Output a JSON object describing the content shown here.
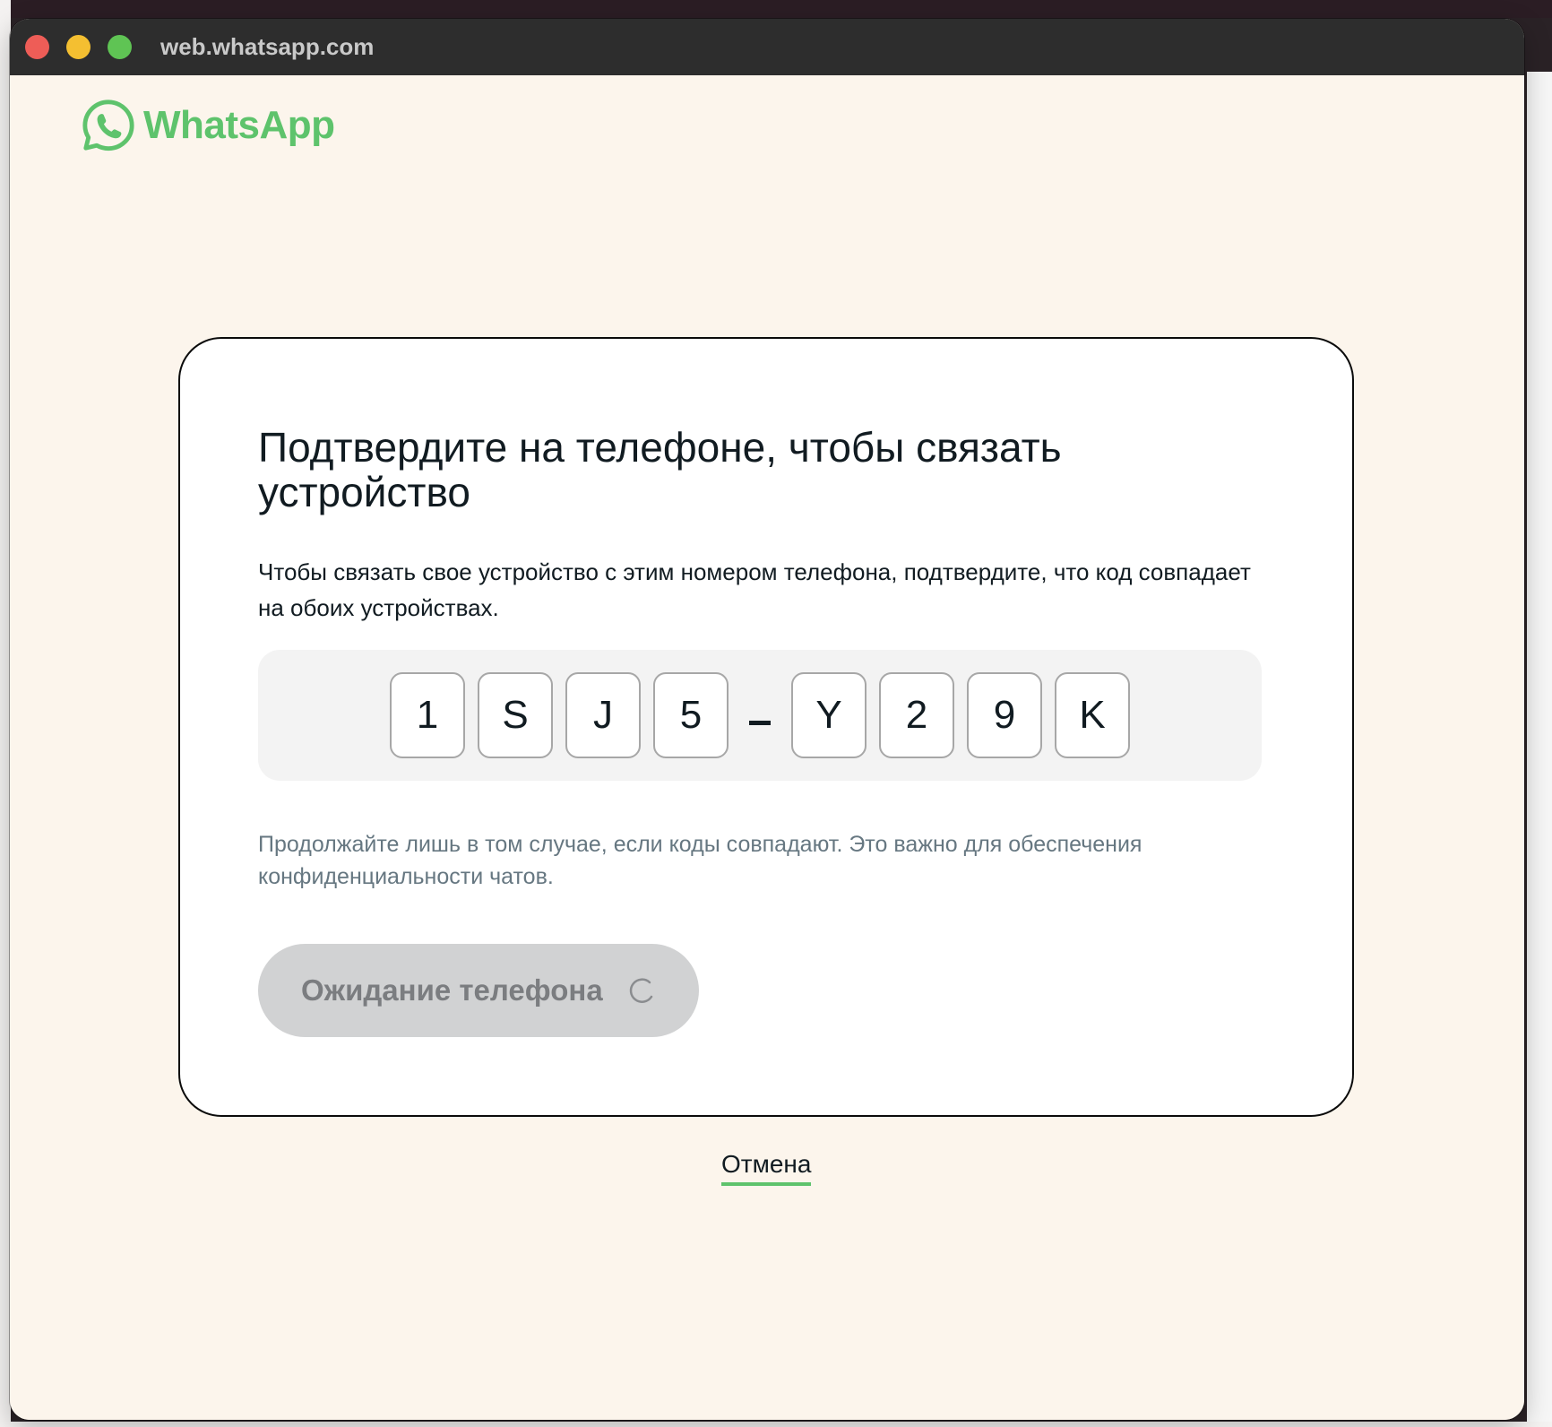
{
  "browser": {
    "url": "web.whatsapp.com"
  },
  "brand": {
    "name": "WhatsApp",
    "color": "#5ec36c",
    "icon": "whatsapp-logo-icon"
  },
  "dialog": {
    "title": "Подтвердите на телефоне, чтобы связать устройство",
    "description": "Чтобы связать свое устройство с этим номером телефона, подтвердите, что код совпадает на обоих устройствах.",
    "code_part1": [
      "1",
      "S",
      "J",
      "5"
    ],
    "code_separator": "-",
    "code_part2": [
      "Y",
      "2",
      "9",
      "K"
    ],
    "note": "Продолжайте лишь в том случае, если коды совпадают. Это важно для обеспечения конфиденциальности чатов.",
    "wait_button_label": "Ожидание телефона",
    "wait_button_icon": "spinner-icon"
  },
  "footer": {
    "cancel_label": "Отмена"
  }
}
